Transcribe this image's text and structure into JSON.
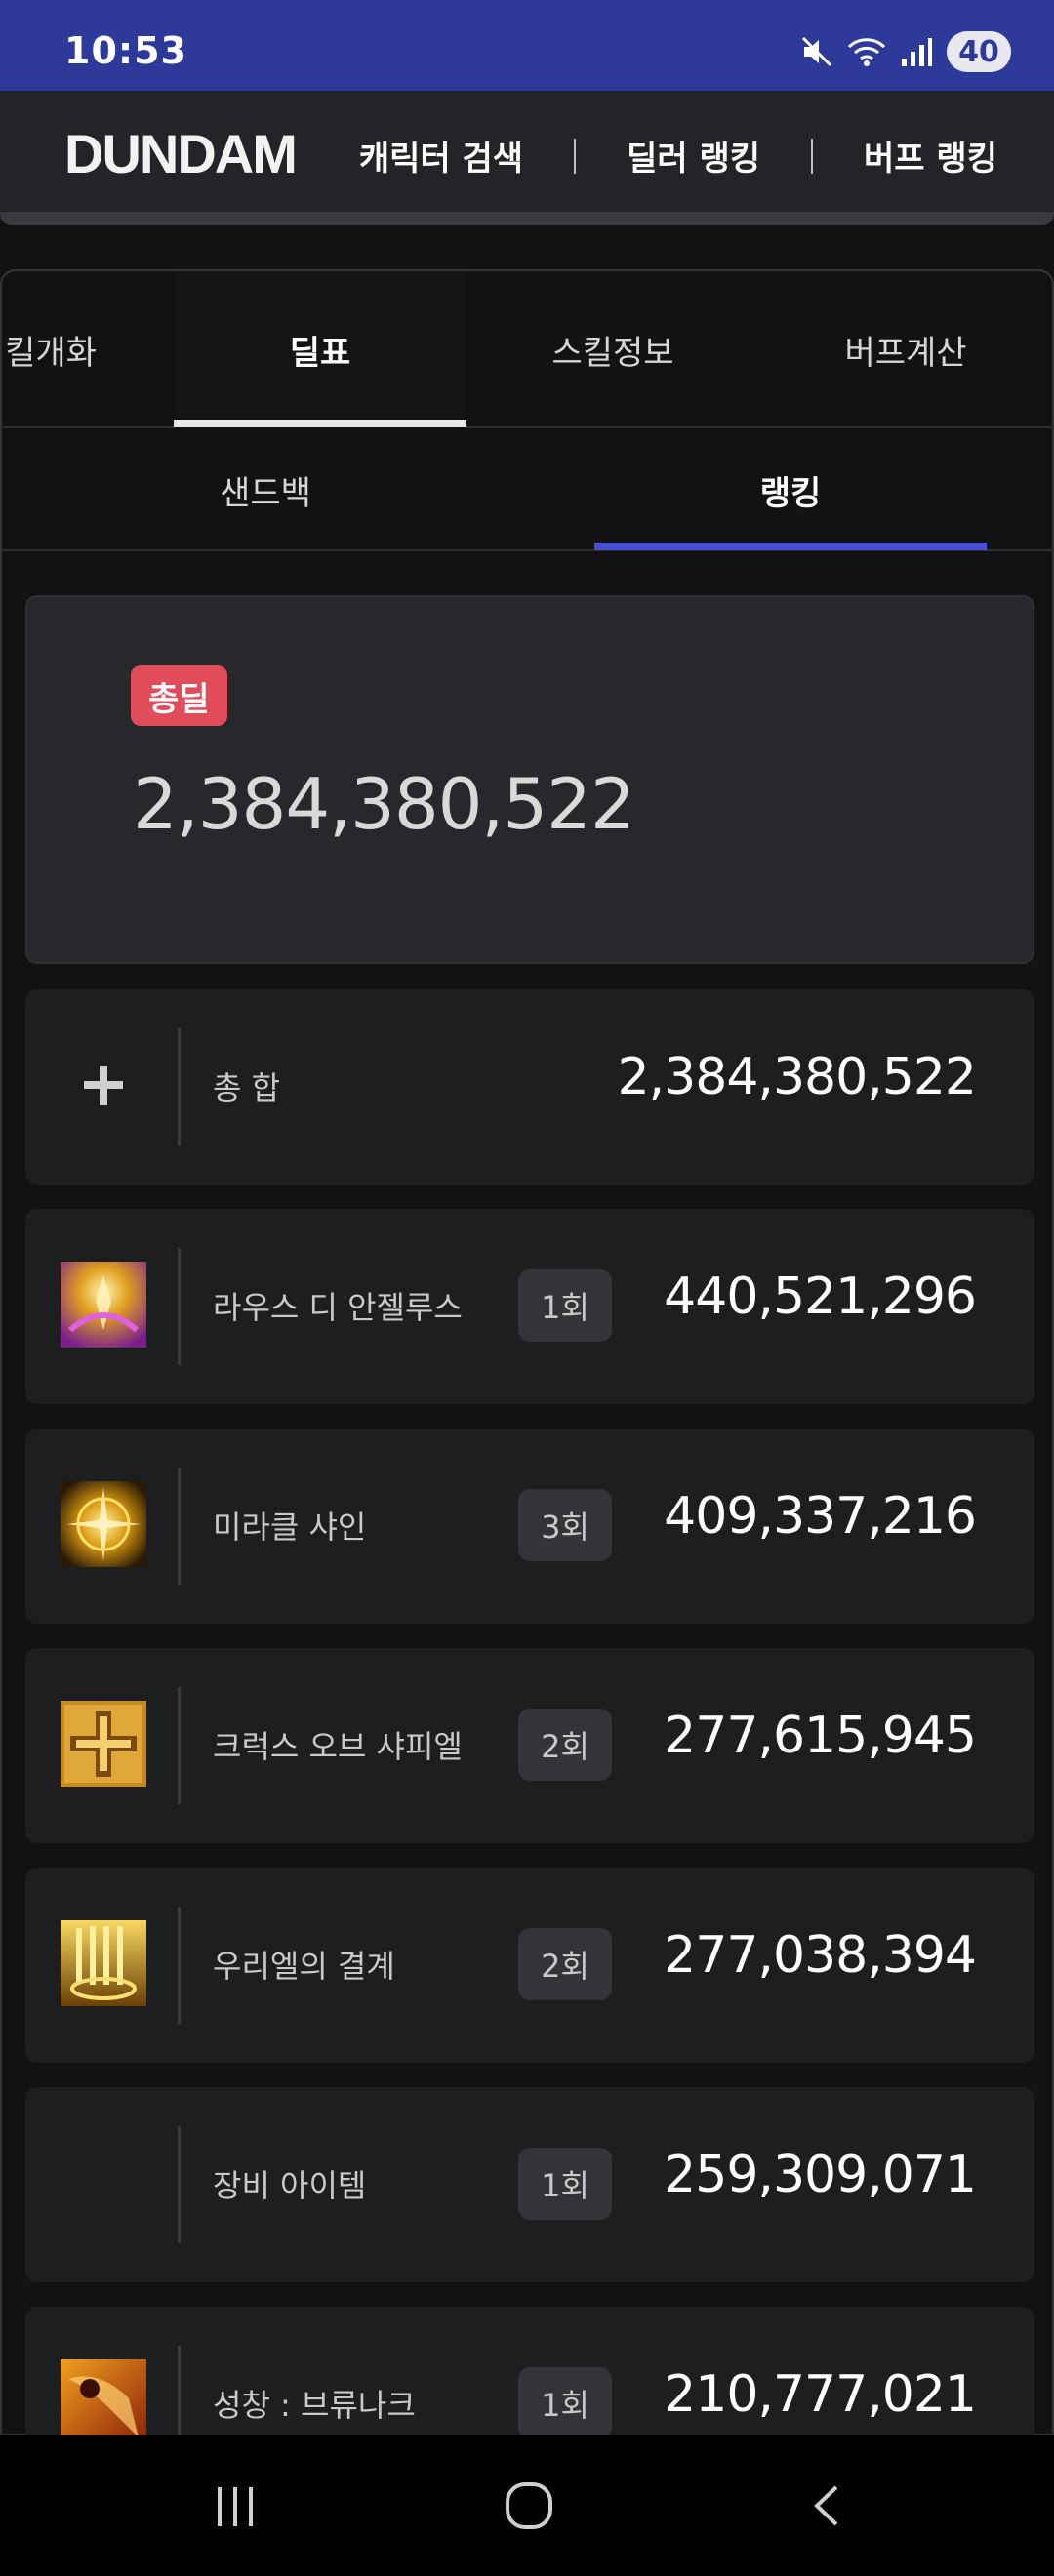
{
  "status_bar": {
    "time": "10:53",
    "battery": "40",
    "icons": [
      "mute-icon",
      "wifi-icon",
      "signal-icon"
    ]
  },
  "header": {
    "logo": "DUNDAM",
    "nav": [
      "캐릭터 검색",
      "딜러 랭킹",
      "버프 랭킹"
    ]
  },
  "tabs": [
    {
      "label": "킬개화",
      "active": false
    },
    {
      "label": "딜표",
      "active": true
    },
    {
      "label": "스킬정보",
      "active": false
    },
    {
      "label": "버프계산",
      "active": false
    }
  ],
  "subtabs": [
    {
      "label": "샌드백",
      "active": false
    },
    {
      "label": "랭킹",
      "active": true
    }
  ],
  "total": {
    "badge": "총딜",
    "value": "2,384,380,522"
  },
  "rows": [
    {
      "icon": "plus-icon",
      "name": "총 합",
      "count": "",
      "value": "2,384,380,522"
    },
    {
      "icon": "laus-di-angelus-skill-icon",
      "name": "라우스 디 안젤루스",
      "count": "1회",
      "value": "440,521,296"
    },
    {
      "icon": "miracle-shine-skill-icon",
      "name": "미라클 샤인",
      "count": "3회",
      "value": "409,337,216"
    },
    {
      "icon": "cross-of-sapphiel-skill-icon",
      "name": "크럭스 오브 샤피엘",
      "count": "2회",
      "value": "277,615,945"
    },
    {
      "icon": "uriel-barrier-skill-icon",
      "name": "우리엘의 결계",
      "count": "2회",
      "value": "277,038,394"
    },
    {
      "icon": "",
      "name": "장비 아이템",
      "count": "1회",
      "value": "259,309,071"
    },
    {
      "icon": "holy-chant-brunac-skill-icon",
      "name": "성창 : 브류나크",
      "count": "1회",
      "value": "210,777,021"
    }
  ],
  "colors": {
    "status_bar": "#2d3a9a",
    "header_bg": "#232427",
    "badge_red": "#e04c5a",
    "active_tab_underline": "#e6e6e6",
    "active_subtab_underline": "#4b4fd6",
    "row_bg": "#1d1e20"
  }
}
